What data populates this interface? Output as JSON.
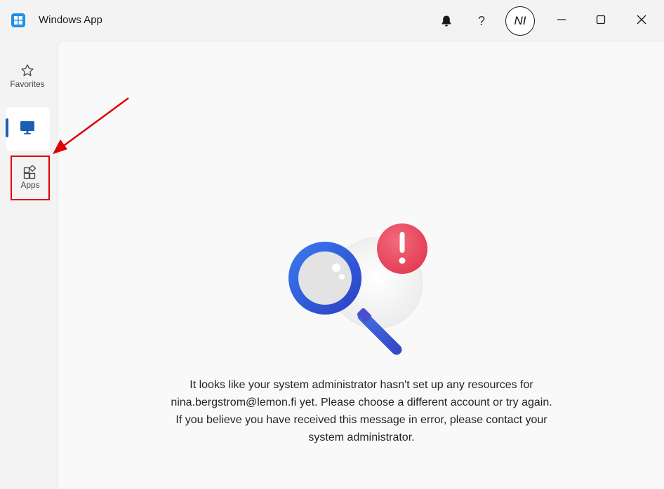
{
  "window": {
    "title": "Windows App",
    "accent_color": "#1a5fb4"
  },
  "titlebar": {
    "help_label": "?",
    "avatar_initials": "NI",
    "icons": [
      "bell-icon",
      "help-icon",
      "minimize-icon",
      "maximize-icon",
      "close-icon"
    ]
  },
  "sidebar": {
    "items": [
      {
        "label": "Favorites",
        "icon": "star-icon"
      },
      {
        "label": "",
        "icon": "monitor-icon",
        "selected": true
      },
      {
        "label": "Apps",
        "icon": "apps-icon",
        "highlighted": true
      }
    ]
  },
  "main": {
    "message_lines": [
      "It looks like your system administrator hasn't set up any resources for",
      "nina.bergstrom@lemon.fi yet. Please choose a different account or try again.",
      "If you believe you have received this message in error, please contact your",
      "system administrator."
    ]
  },
  "annotation": {
    "color": "#e00000"
  }
}
